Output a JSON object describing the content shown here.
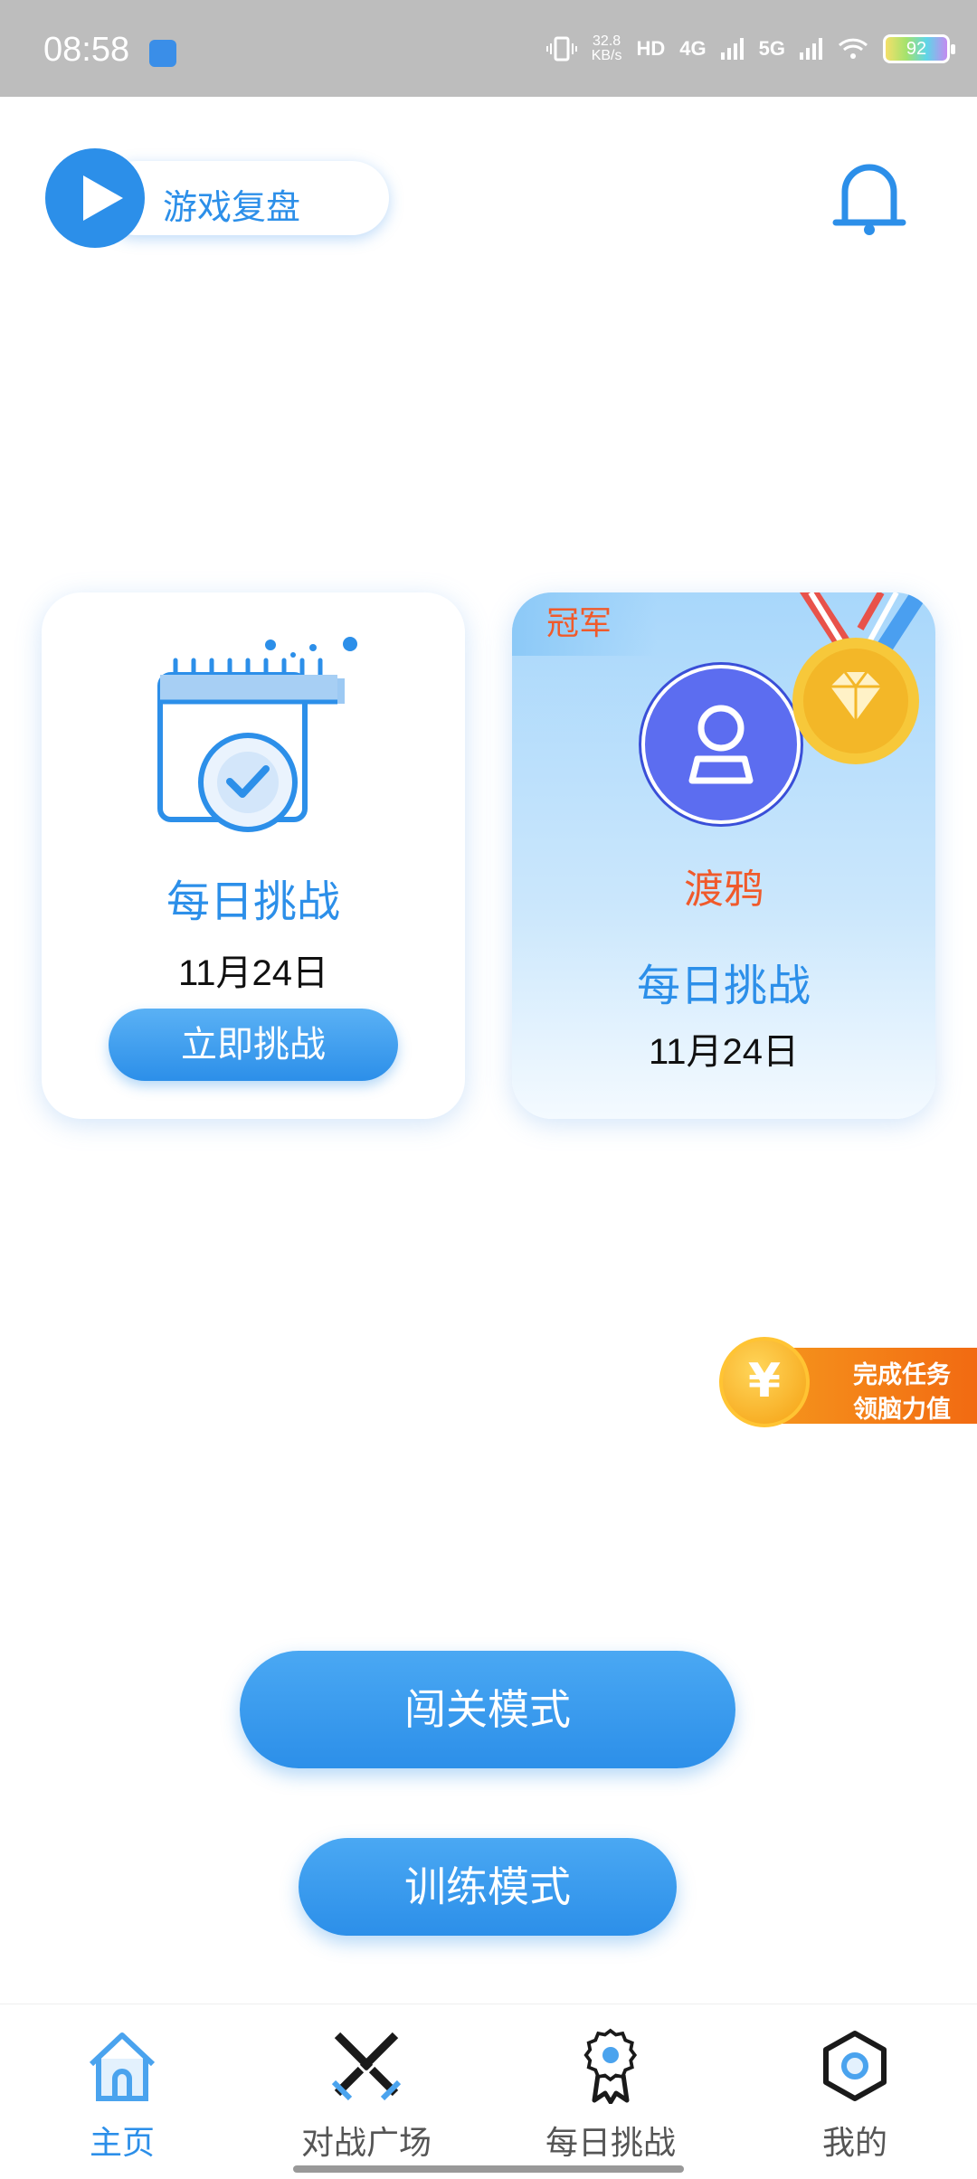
{
  "status_bar": {
    "time": "08:58",
    "net_speed_value": "32.8",
    "net_speed_unit": "KB/s",
    "hd_label": "HD",
    "net1": "4G",
    "net2": "5G",
    "battery": "92"
  },
  "header": {
    "replay_label": "游戏复盘",
    "bell_icon": "bell-icon"
  },
  "daily_card": {
    "title": "每日挑战",
    "date": "11月24日",
    "button_label": "立即挑战"
  },
  "champion_card": {
    "tag": "冠军",
    "player_name": "渡鸦",
    "title": "每日挑战",
    "date": "11月24日"
  },
  "task_banner": {
    "coin_symbol": "¥",
    "line1": "完成任务",
    "line2": "领脑力值"
  },
  "modes": {
    "level_mode": "闯关模式",
    "training_mode": "训练模式"
  },
  "nav": {
    "items": [
      {
        "label": "主页",
        "icon": "home-icon",
        "active": true
      },
      {
        "label": "对战广场",
        "icon": "swords-icon",
        "active": false
      },
      {
        "label": "每日挑战",
        "icon": "badge-icon",
        "active": false
      },
      {
        "label": "我的",
        "icon": "hexagon-icon",
        "active": false
      }
    ]
  },
  "colors": {
    "accent": "#2c8fe9",
    "champion_text": "#f05a2b",
    "status_bar": "#bdbdbd"
  }
}
